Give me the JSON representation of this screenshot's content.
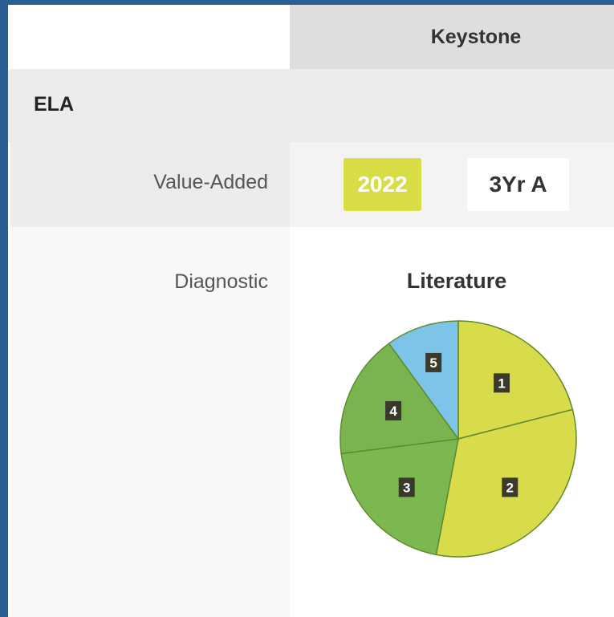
{
  "header": {
    "column_title": "Keystone"
  },
  "section": {
    "title": "ELA"
  },
  "rows": {
    "value_added": {
      "label": "Value-Added",
      "buttons": [
        {
          "label": "2022",
          "selected": true
        },
        {
          "label": "3Yr A",
          "selected": false
        }
      ]
    },
    "diagnostic": {
      "label": "Diagnostic"
    }
  },
  "colors": {
    "selected_button": "#d8dc45",
    "slice_yellow": "#d9dc4a",
    "slice_green": "#7bb950",
    "slice_light_green": "#79b44e",
    "slice_blue": "#7cc5e8"
  },
  "chart_data": {
    "type": "pie",
    "title": "Literature",
    "slices": [
      {
        "label": "1",
        "value": 21,
        "color": "#d9dc4a"
      },
      {
        "label": "2",
        "value": 32,
        "color": "#d9dc4a"
      },
      {
        "label": "3",
        "value": 20,
        "color": "#7bb950"
      },
      {
        "label": "4",
        "value": 17,
        "color": "#79b44e"
      },
      {
        "label": "5",
        "value": 10,
        "color": "#7cc5e8"
      }
    ]
  }
}
